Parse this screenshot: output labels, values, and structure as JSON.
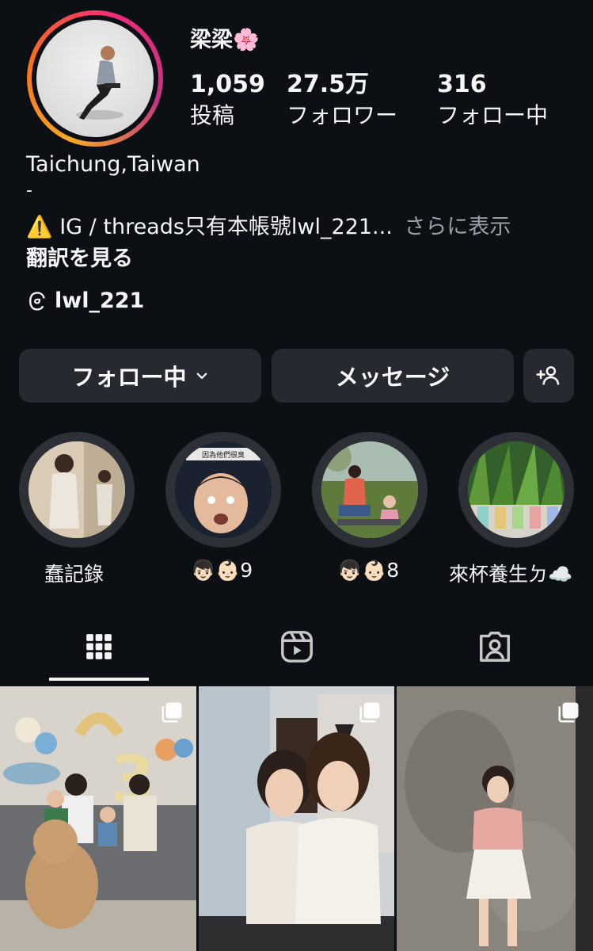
{
  "profile": {
    "username": "梁梁",
    "username_emoji": "🌸",
    "stats": [
      {
        "value": "1,059",
        "label": "投稿"
      },
      {
        "value": "27.5万",
        "label": "フォロワー"
      },
      {
        "value": "316",
        "label": "フォロー中"
      }
    ],
    "location": "Taichung,Taiwan",
    "dash": "-",
    "bio_warning_emoji": "⚠️",
    "bio_text": "IG / threads只有本帳號lwl_221...",
    "see_more": "さらに表示",
    "translate": "翻訳を見る",
    "threads_handle": "lwl_221"
  },
  "actions": {
    "following_label": "フォロー中",
    "message_label": "メッセージ",
    "add_user_icon": "person-add-icon"
  },
  "highlights": [
    {
      "label": "蠢記錄"
    },
    {
      "label": "👦🏻👶🏻9"
    },
    {
      "label": "👦🏻👶🏻8"
    },
    {
      "label": "來杯養生ㄉ☁️"
    }
  ],
  "highlight_overlay_text": "因為他們很臭",
  "tabs": [
    {
      "name": "posts-grid-icon",
      "active": true
    },
    {
      "name": "reels-icon",
      "active": false
    },
    {
      "name": "tagged-icon",
      "active": false
    }
  ],
  "posts": [
    {
      "name": "post-birthday-family",
      "balloon_number": "3"
    },
    {
      "name": "post-two-women"
    },
    {
      "name": "post-woman-concrete-wall"
    }
  ],
  "colors": {
    "background": "#0c0f14",
    "button": "#262a30",
    "muted": "#9aa0a6",
    "story_ring": [
      "#f9a825",
      "#ee2a7b",
      "#c13584"
    ]
  }
}
